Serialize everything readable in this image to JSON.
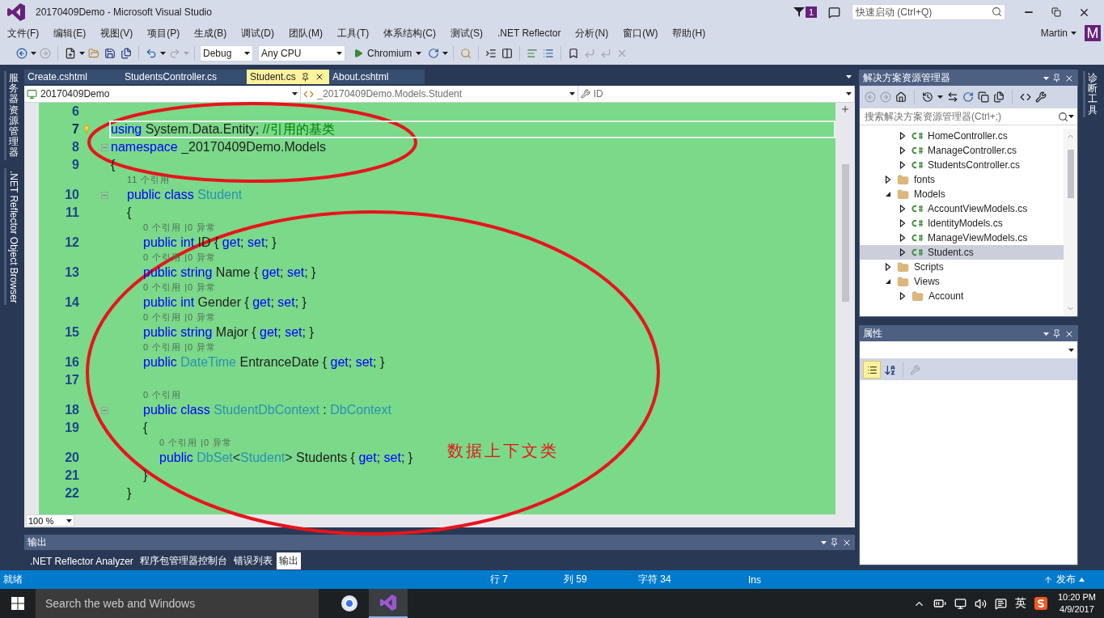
{
  "window": {
    "title": "20170409Demo - Microsoft Visual Studio",
    "notification_count": "1",
    "quick_launch": {
      "placeholder": "快速启动 (Ctrl+Q)"
    }
  },
  "menu": [
    "文件(F)",
    "编辑(E)",
    "视图(V)",
    "项目(P)",
    "生成(B)",
    "调试(D)",
    "团队(M)",
    "工具(T)",
    "体系结构(C)",
    "测试(S)",
    ".NET Reflector",
    "分析(N)",
    "窗口(W)",
    "帮助(H)"
  ],
  "account": {
    "name": "Martin",
    "initial": "M"
  },
  "toolbar": {
    "configuration": "Debug",
    "platform": "Any CPU",
    "run_target": "Chromium"
  },
  "side_tabs_left": [
    {
      "label": "服务器资源管理器",
      "kind": "cjk"
    },
    {
      "label": ".NET Reflector Object Browser",
      "kind": "latin"
    }
  ],
  "document_tabs": [
    {
      "label": "Create.cshtml",
      "selected": false
    },
    {
      "label": "StudentsController.cs",
      "selected": false
    },
    {
      "label": "Student.cs",
      "selected": true
    },
    {
      "label": "About.cshtml",
      "selected": false
    }
  ],
  "navigation": {
    "project": "20170409Demo",
    "type": "_20170409Demo.Models.Student",
    "member": "ID"
  },
  "code_lines": [
    {
      "kind": "code",
      "number": "6",
      "current": false,
      "fold": false
    },
    {
      "kind": "code",
      "number": "7",
      "current": true,
      "fold": false,
      "tokens": [
        {
          "kind": "keyword",
          "s": "using"
        },
        {
          "kind": "plain",
          "s": " System.Data.Entity; "
        },
        {
          "kind": "comment",
          "s": "//引用的基类"
        }
      ]
    },
    {
      "kind": "code",
      "number": "8",
      "current": false,
      "fold": true,
      "tokens": [
        {
          "kind": "keyword",
          "s": "namespace"
        },
        {
          "kind": "plain",
          "s": " _20170409Demo.Models"
        }
      ]
    },
    {
      "kind": "code",
      "number": "9",
      "current": false,
      "fold": false,
      "tokens": [
        {
          "kind": "plain",
          "s": "{"
        }
      ],
      "children": [
        {
          "kind": "lens",
          "text": "11 个引用"
        },
        {
          "kind": "code",
          "number": "10",
          "current": false,
          "fold": true,
          "tokens": [
            {
              "kind": "keyword",
              "s": "public class "
            },
            {
              "kind": "type",
              "s": "Student"
            }
          ]
        },
        {
          "kind": "code",
          "number": "11",
          "current": false,
          "fold": false,
          "tokens": [
            {
              "kind": "plain",
              "s": "{"
            }
          ],
          "children": [
            {
              "kind": "lens",
              "text": "0 个引用 |0 异常"
            },
            {
              "kind": "code",
              "number": "12",
              "current": false,
              "fold": false,
              "tokens": [
                {
                  "kind": "keyword",
                  "s": "public int"
                },
                {
                  "kind": "plain",
                  "s": " ID { "
                },
                {
                  "kind": "keyword",
                  "s": "get"
                },
                {
                  "kind": "plain",
                  "s": "; "
                },
                {
                  "kind": "keyword",
                  "s": "set"
                },
                {
                  "kind": "plain",
                  "s": "; }"
                }
              ]
            },
            {
              "kind": "lens",
              "text": "0 个引用 |0 异常"
            },
            {
              "kind": "code",
              "number": "13",
              "current": false,
              "fold": false,
              "tokens": [
                {
                  "kind": "keyword",
                  "s": "public string"
                },
                {
                  "kind": "plain",
                  "s": " Name { "
                },
                {
                  "kind": "keyword",
                  "s": "get"
                },
                {
                  "kind": "plain",
                  "s": "; "
                },
                {
                  "kind": "keyword",
                  "s": "set"
                },
                {
                  "kind": "plain",
                  "s": "; }"
                }
              ]
            },
            {
              "kind": "lens",
              "text": "0 个引用 |0 异常"
            },
            {
              "kind": "code",
              "number": "14",
              "current": false,
              "fold": false,
              "tokens": [
                {
                  "kind": "keyword",
                  "s": "public int"
                },
                {
                  "kind": "plain",
                  "s": " Gender { "
                },
                {
                  "kind": "keyword",
                  "s": "get"
                },
                {
                  "kind": "plain",
                  "s": "; "
                },
                {
                  "kind": "keyword",
                  "s": "set"
                },
                {
                  "kind": "plain",
                  "s": "; }"
                }
              ]
            },
            {
              "kind": "lens",
              "text": "0 个引用 |0 异常"
            },
            {
              "kind": "code",
              "number": "15",
              "current": false,
              "fold": false,
              "tokens": [
                {
                  "kind": "keyword",
                  "s": "public string"
                },
                {
                  "kind": "plain",
                  "s": " Major { "
                },
                {
                  "kind": "keyword",
                  "s": "get"
                },
                {
                  "kind": "plain",
                  "s": "; "
                },
                {
                  "kind": "keyword",
                  "s": "set"
                },
                {
                  "kind": "plain",
                  "s": "; }"
                }
              ]
            },
            {
              "kind": "lens",
              "text": "0 个引用 |0 异常"
            },
            {
              "kind": "code",
              "number": "16",
              "current": false,
              "fold": false,
              "tokens": [
                {
                  "kind": "keyword",
                  "s": "public "
                },
                {
                  "kind": "type",
                  "s": "DateTime"
                },
                {
                  "kind": "plain",
                  "s": " EntranceDate { "
                },
                {
                  "kind": "keyword",
                  "s": "get"
                },
                {
                  "kind": "plain",
                  "s": "; "
                },
                {
                  "kind": "keyword",
                  "s": "set"
                },
                {
                  "kind": "plain",
                  "s": "; }"
                }
              ]
            },
            {
              "kind": "code",
              "number": "17",
              "current": false,
              "fold": false
            },
            {
              "kind": "lens",
              "text": "0 个引用"
            },
            {
              "kind": "code",
              "number": "18",
              "current": false,
              "fold": true,
              "tokens": [
                {
                  "kind": "keyword",
                  "s": "public class "
                },
                {
                  "kind": "type",
                  "s": "StudentDbContext"
                },
                {
                  "kind": "plain",
                  "s": " : "
                },
                {
                  "kind": "type",
                  "s": "DbContext"
                }
              ]
            },
            {
              "kind": "code",
              "number": "19",
              "current": false,
              "fold": false,
              "tokens": [
                {
                  "kind": "plain",
                  "s": "{"
                }
              ],
              "children": [
                {
                  "kind": "lens",
                  "text": "0 个引用 |0 异常"
                },
                {
                  "kind": "code",
                  "number": "20",
                  "current": false,
                  "fold": false,
                  "tokens": [
                    {
                      "kind": "keyword",
                      "s": "public "
                    },
                    {
                      "kind": "type",
                      "s": "DbSet"
                    },
                    {
                      "kind": "plain",
                      "s": "<"
                    },
                    {
                      "kind": "type",
                      "s": "Student"
                    },
                    {
                      "kind": "plain",
                      "s": "> Students { "
                    },
                    {
                      "kind": "keyword",
                      "s": "get"
                    },
                    {
                      "kind": "plain",
                      "s": "; "
                    },
                    {
                      "kind": "keyword",
                      "s": "set"
                    },
                    {
                      "kind": "plain",
                      "s": "; }"
                    }
                  ]
                }
              ]
            },
            {
              "kind": "code",
              "number": "21",
              "current": false,
              "fold": false,
              "tokens": [
                {
                  "kind": "plain",
                  "s": "}"
                }
              ]
            }
          ]
        },
        {
          "kind": "code",
          "number": "22",
          "current": false,
          "fold": false,
          "tokens": [
            {
              "kind": "plain",
              "s": "}"
            }
          ]
        }
      ]
    }
  ],
  "zoom": "100 %",
  "output": {
    "title": "输出",
    "tabs": [
      {
        "label": ".NET Reflector Analyzer",
        "selected": false
      },
      {
        "label": "程序包管理器控制台",
        "selected": false
      },
      {
        "label": "错误列表",
        "selected": false
      },
      {
        "label": "输出",
        "selected": true
      }
    ]
  },
  "solution_explorer": {
    "title": "解决方案资源管理器",
    "search": {
      "placeholder": "搜索解决方案资源管理器(Ctrl+;)"
    },
    "tree": [
      {
        "kind": "group",
        "children": [
          {
            "label": "HomeController.cs",
            "kind": "csharp",
            "expanded": false,
            "selected": false
          },
          {
            "label": "ManageController.cs",
            "kind": "csharp",
            "expanded": false,
            "selected": false
          },
          {
            "label": "StudentsController.cs",
            "kind": "csharp",
            "expanded": false,
            "selected": false
          }
        ]
      },
      {
        "label": "fonts",
        "kind": "folder",
        "expanded": false,
        "selected": false
      },
      {
        "label": "Models",
        "kind": "folder",
        "expanded": true,
        "selected": false,
        "children": [
          {
            "label": "AccountViewModels.cs",
            "kind": "csharp",
            "expanded": false,
            "selected": false
          },
          {
            "label": "IdentityModels.cs",
            "kind": "csharp",
            "expanded": false,
            "selected": false
          },
          {
            "label": "ManageViewModels.cs",
            "kind": "csharp",
            "expanded": false,
            "selected": false
          },
          {
            "label": "Student.cs",
            "kind": "csharp",
            "expanded": false,
            "selected": true
          }
        ]
      },
      {
        "label": "Scripts",
        "kind": "folder",
        "expanded": false,
        "selected": false
      },
      {
        "label": "Views",
        "kind": "folder",
        "expanded": true,
        "selected": false,
        "children": [
          {
            "label": "Account",
            "kind": "folder",
            "expanded": false,
            "selected": false
          }
        ]
      }
    ]
  },
  "properties": {
    "title": "属性"
  },
  "side_tabs_right": [
    {
      "label": "诊断工具",
      "kind": "cjk"
    }
  ],
  "status_bar": {
    "state": "就绪",
    "line": "行 7",
    "column": "列 59",
    "character": "字符 34",
    "mode": "Ins",
    "publish": "发布"
  },
  "taskbar": {
    "search": {
      "placeholder": "Search the web and Windows"
    },
    "ime": "英",
    "time": "10:20 PM",
    "date": "4/9/2017"
  },
  "annotations": [
    {
      "kind": "ellipse"
    },
    {
      "kind": "ellipse"
    },
    {
      "kind": "text",
      "text": "数据上下文类"
    }
  ]
}
